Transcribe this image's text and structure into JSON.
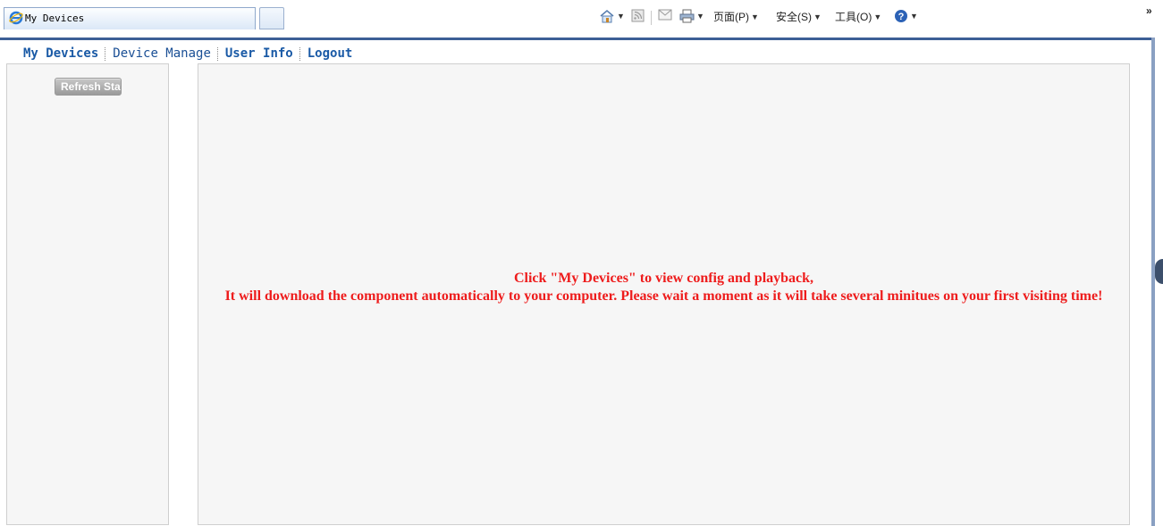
{
  "browser": {
    "tab_title": "My Devices",
    "toolbar": {
      "page_label": "页面(P)",
      "safety_label": "安全(S)",
      "tools_label": "工具(O)",
      "overflow_label": "»"
    }
  },
  "nav": {
    "items": [
      {
        "label": "My Devices"
      },
      {
        "label": "Device Manage"
      },
      {
        "label": "User Info"
      },
      {
        "label": "Logout"
      }
    ]
  },
  "left_panel": {
    "refresh_label": "Refresh Stat"
  },
  "main_panel": {
    "notice_line1": "Click \"My Devices\" to view config and playback,",
    "notice_line2": "It will download the component automatically to your computer. Please wait a moment as it will take several minitues on your first visiting time!"
  },
  "colors": {
    "nav_link": "#1a5aa6",
    "notice_text": "#ee1c1c",
    "panel_bg": "#f6f6f6"
  }
}
